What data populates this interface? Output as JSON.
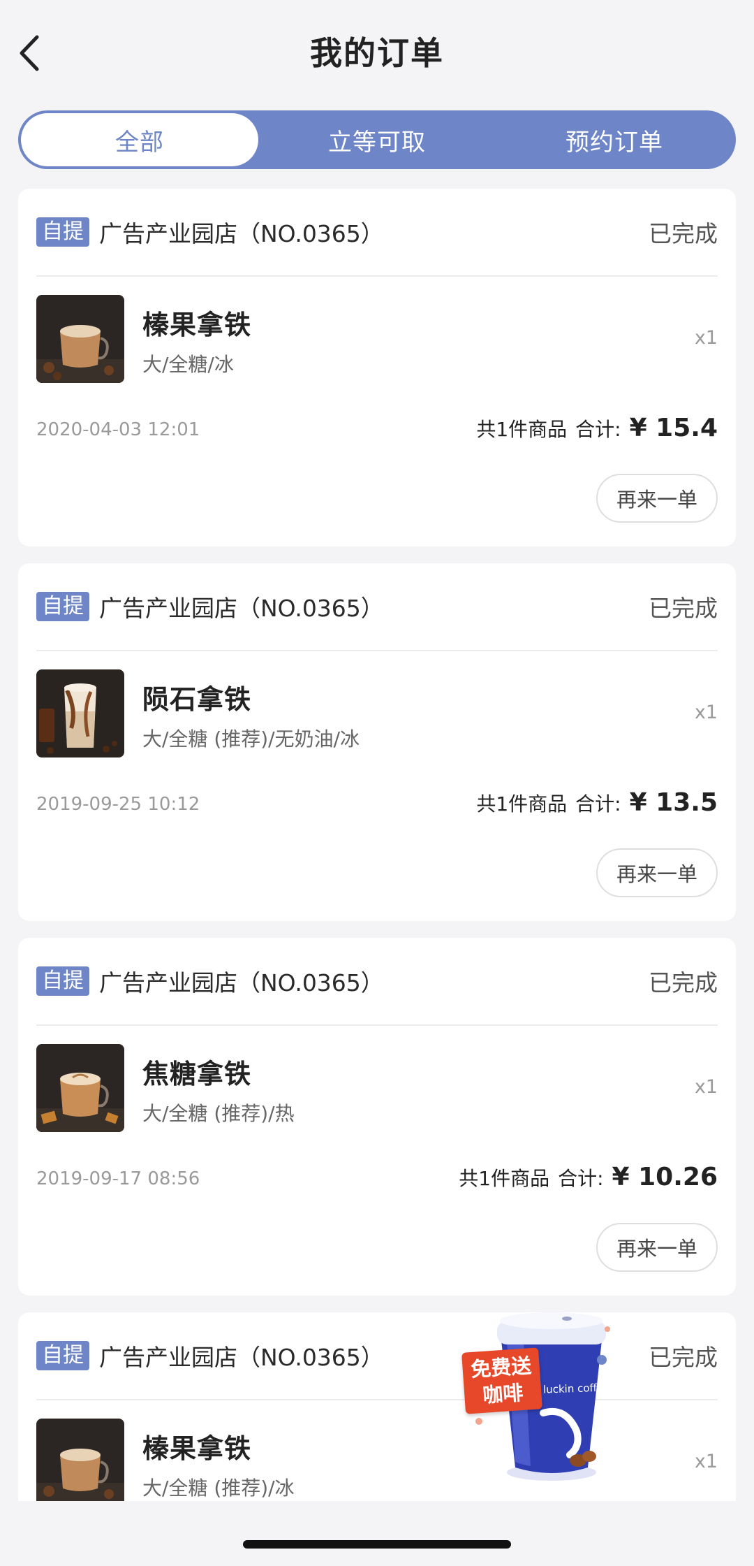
{
  "header": {
    "title": "我的订单"
  },
  "tabs": [
    {
      "label": "全部",
      "active": true
    },
    {
      "label": "立等可取",
      "active": false
    },
    {
      "label": "预约订单",
      "active": false
    }
  ],
  "orders": [
    {
      "badge": "自提",
      "store": "广告产业园店（NO.0365）",
      "status": "已完成",
      "product_name": "榛果拿铁",
      "product_spec": "大/全糖/冰",
      "qty": "x1",
      "date": "2020-04-03 12:01",
      "count_text": "共1件商品",
      "total_label": "合计:",
      "total": "¥ 15.4",
      "reorder": "再来一单"
    },
    {
      "badge": "自提",
      "store": "广告产业园店（NO.0365）",
      "status": "已完成",
      "product_name": "陨石拿铁",
      "product_spec": "大/全糖 (推荐)/无奶油/冰",
      "qty": "x1",
      "date": "2019-09-25 10:12",
      "count_text": "共1件商品",
      "total_label": "合计:",
      "total": "¥ 13.5",
      "reorder": "再来一单"
    },
    {
      "badge": "自提",
      "store": "广告产业园店（NO.0365）",
      "status": "已完成",
      "product_name": "焦糖拿铁",
      "product_spec": "大/全糖 (推荐)/热",
      "qty": "x1",
      "date": "2019-09-17 08:56",
      "count_text": "共1件商品",
      "total_label": "合计:",
      "total": "¥ 10.26",
      "reorder": "再来一单"
    },
    {
      "badge": "自提",
      "store": "广告产业园店（NO.0365）",
      "status": "已完成",
      "product_name": "榛果拿铁",
      "product_spec": "大/全糖 (推荐)/冰",
      "qty": "x1"
    }
  ],
  "promo": {
    "label_line1": "免费送",
    "label_line2": "咖啡",
    "brand": "luckin coffee"
  },
  "colors": {
    "accent": "#6e86c7",
    "background": "#f4f4f6",
    "promo_red": "#e8482a",
    "cup_blue": "#2f3fb3"
  },
  "icons": {
    "back": "chevron-left-icon",
    "thumb_1": "hazelnut-latte-image",
    "thumb_2": "meteorite-latte-image",
    "thumb_3": "caramel-latte-image"
  }
}
